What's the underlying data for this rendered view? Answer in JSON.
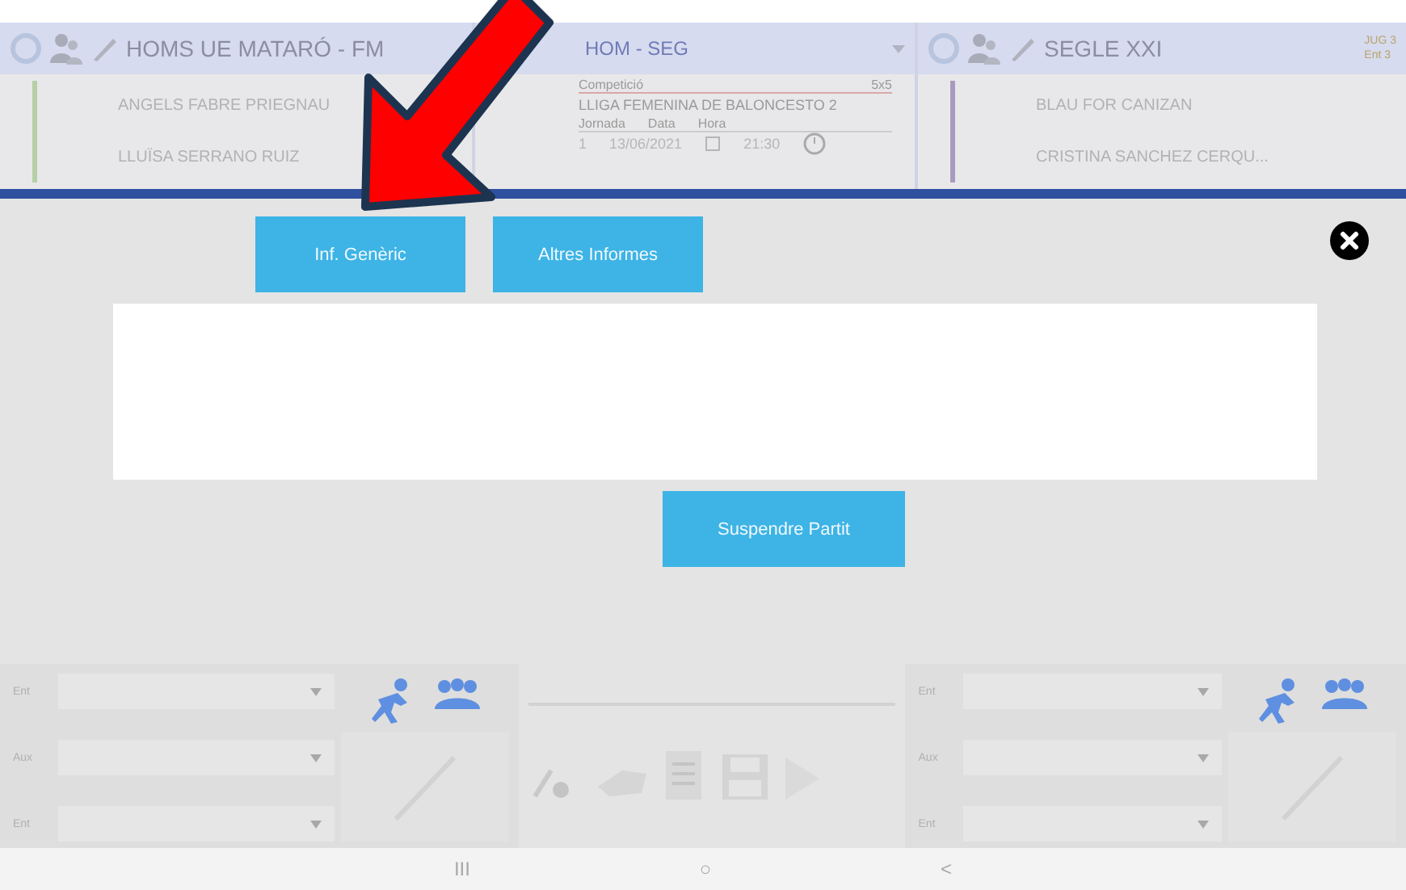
{
  "home_team": {
    "name": "HOMS UE MATARÓ - FM",
    "players": [
      "ANGELS FABRE PRIEGNAU",
      "LLUÏSA SERRANO RUIZ"
    ]
  },
  "match": {
    "title": "HOM - SEG",
    "competition_label": "Competició",
    "format": "5x5",
    "competition": "LLIGA FEMENINA DE BALONCESTO 2",
    "round_label": "Jornada",
    "date_label": "Data",
    "time_label": "Hora",
    "round": "1",
    "date": "13/06/2021",
    "time": "21:30"
  },
  "away_team": {
    "name": "SEGLE XXI",
    "stats": [
      "JUG 3",
      "Ent 3"
    ],
    "players": [
      "BLAU FOR CANIZAN",
      "CRISTINA SANCHEZ CERQU..."
    ]
  },
  "dialog": {
    "tabs": [
      "Inf. Genèric",
      "Altres Informes"
    ],
    "action": "Suspendre Partit"
  },
  "home_staff": [
    "Ent",
    "Aux",
    "Ent"
  ],
  "away_staff": [
    "Ent",
    "Aux",
    "Ent"
  ],
  "nav": [
    "III",
    "○",
    "<"
  ]
}
